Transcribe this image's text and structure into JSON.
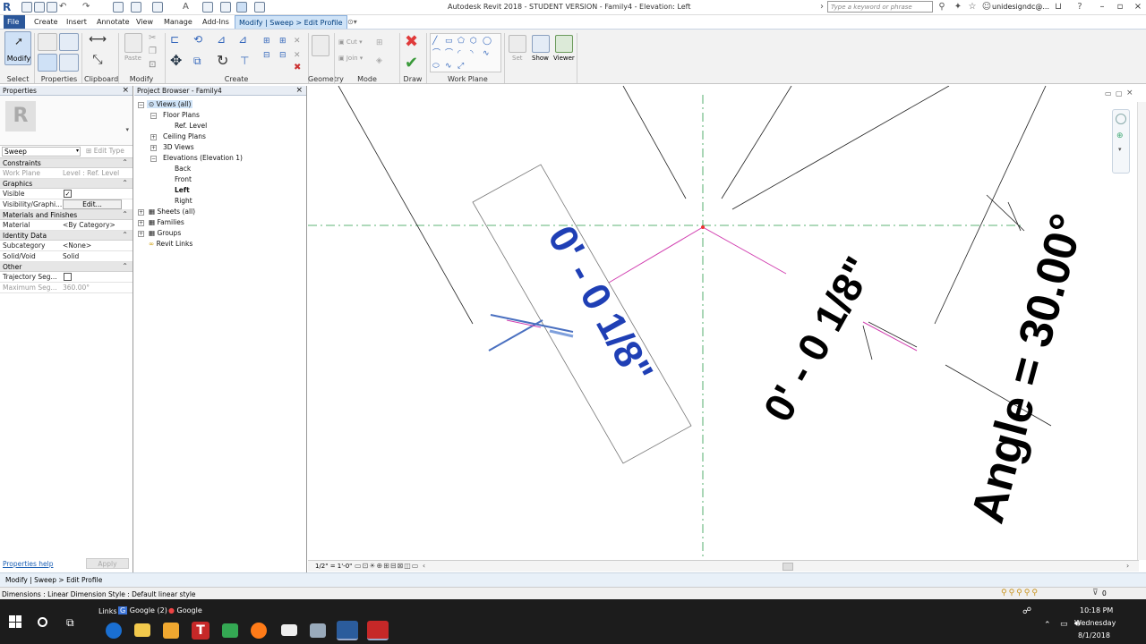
{
  "window": {
    "title": "Autodesk Revit 2018 - STUDENT VERSION -    Family4 - Elevation: Left",
    "search_placeholder": "Type a keyword or phrase",
    "user": "unidesigndc@..."
  },
  "menu": {
    "items": [
      "File",
      "Create",
      "Insert",
      "Annotate",
      "View",
      "Manage",
      "Add-Ins",
      "Modify | Sweep > Edit Profile"
    ]
  },
  "ribbon": {
    "groups": [
      "Select",
      "Properties",
      "Clipboard",
      "Modify",
      "Create",
      "Geometry",
      "Mode",
      "Draw",
      "Work Plane"
    ],
    "modify_label": "Modify",
    "paste_label": "Paste",
    "cut_label": "Cut",
    "join_label": "Join",
    "set_label": "Set",
    "show_label": "Show",
    "viewer_label": "Viewer"
  },
  "properties": {
    "title": "Properties",
    "type_name": "Sweep",
    "edit_type": "Edit Type",
    "categories": {
      "constraints": "Constraints",
      "graphics": "Graphics",
      "materials": "Materials and Finishes",
      "identity": "Identity Data",
      "other": "Other"
    },
    "rows": {
      "work_plane_k": "Work Plane",
      "work_plane_v": "Level : Ref. Level",
      "visible_k": "Visible",
      "visgraph_k": "Visibility/Graphi...",
      "visgraph_v": "Edit...",
      "material_k": "Material",
      "material_v": "<By Category>",
      "subcat_k": "Subcategory",
      "subcat_v": "<None>",
      "solidvoid_k": "Solid/Void",
      "solidvoid_v": "Solid",
      "traj_k": "Trajectory Seg...",
      "maxseg_k": "Maximum Seg...",
      "maxseg_v": "360.00°"
    },
    "help": "Properties help",
    "apply": "Apply"
  },
  "browser": {
    "title": "Project Browser - Family4",
    "nodes": {
      "views": "Views (all)",
      "floor": "Floor Plans",
      "reflevel": "Ref. Level",
      "ceiling": "Ceiling Plans",
      "v3d": "3D Views",
      "elev": "Elevations (Elevation 1)",
      "back": "Back",
      "front": "Front",
      "left": "Left",
      "right": "Right",
      "sheets": "Sheets (all)",
      "families": "Families",
      "groups": "Groups",
      "links": "Revit Links"
    }
  },
  "canvas": {
    "dim_blue": "0' - 0 1/8\"",
    "dim_black": "0' - 0 1/8\"",
    "angle_text": "Angle = 30.00°"
  },
  "viewbar": {
    "scale": "1/2\" = 1'-0\""
  },
  "status": {
    "context": "Modify | Sweep > Edit Profile",
    "hint": "Dimensions : Linear Dimension Style : Default linear style",
    "filter_count": "0"
  },
  "taskbar": {
    "links": "Links",
    "google2": "Google (2)",
    "google": "Google",
    "time": "10:18 PM",
    "day": "Wednesday",
    "date": "8/1/2018"
  },
  "colors": {
    "accent": "#2b579a",
    "dim_blue": "#1f3fb5",
    "profile_magenta": "#d13fb0"
  }
}
